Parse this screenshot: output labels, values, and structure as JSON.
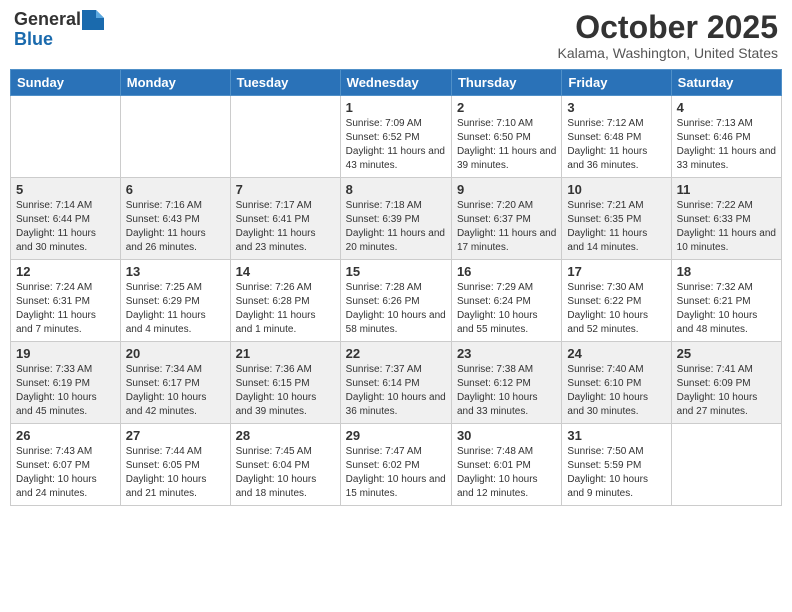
{
  "header": {
    "logo_general": "General",
    "logo_blue": "Blue",
    "month": "October 2025",
    "location": "Kalama, Washington, United States"
  },
  "days_of_week": [
    "Sunday",
    "Monday",
    "Tuesday",
    "Wednesday",
    "Thursday",
    "Friday",
    "Saturday"
  ],
  "weeks": [
    [
      {
        "day": "",
        "sunrise": "",
        "sunset": "",
        "daylight": ""
      },
      {
        "day": "",
        "sunrise": "",
        "sunset": "",
        "daylight": ""
      },
      {
        "day": "",
        "sunrise": "",
        "sunset": "",
        "daylight": ""
      },
      {
        "day": "1",
        "sunrise": "Sunrise: 7:09 AM",
        "sunset": "Sunset: 6:52 PM",
        "daylight": "Daylight: 11 hours and 43 minutes."
      },
      {
        "day": "2",
        "sunrise": "Sunrise: 7:10 AM",
        "sunset": "Sunset: 6:50 PM",
        "daylight": "Daylight: 11 hours and 39 minutes."
      },
      {
        "day": "3",
        "sunrise": "Sunrise: 7:12 AM",
        "sunset": "Sunset: 6:48 PM",
        "daylight": "Daylight: 11 hours and 36 minutes."
      },
      {
        "day": "4",
        "sunrise": "Sunrise: 7:13 AM",
        "sunset": "Sunset: 6:46 PM",
        "daylight": "Daylight: 11 hours and 33 minutes."
      }
    ],
    [
      {
        "day": "5",
        "sunrise": "Sunrise: 7:14 AM",
        "sunset": "Sunset: 6:44 PM",
        "daylight": "Daylight: 11 hours and 30 minutes."
      },
      {
        "day": "6",
        "sunrise": "Sunrise: 7:16 AM",
        "sunset": "Sunset: 6:43 PM",
        "daylight": "Daylight: 11 hours and 26 minutes."
      },
      {
        "day": "7",
        "sunrise": "Sunrise: 7:17 AM",
        "sunset": "Sunset: 6:41 PM",
        "daylight": "Daylight: 11 hours and 23 minutes."
      },
      {
        "day": "8",
        "sunrise": "Sunrise: 7:18 AM",
        "sunset": "Sunset: 6:39 PM",
        "daylight": "Daylight: 11 hours and 20 minutes."
      },
      {
        "day": "9",
        "sunrise": "Sunrise: 7:20 AM",
        "sunset": "Sunset: 6:37 PM",
        "daylight": "Daylight: 11 hours and 17 minutes."
      },
      {
        "day": "10",
        "sunrise": "Sunrise: 7:21 AM",
        "sunset": "Sunset: 6:35 PM",
        "daylight": "Daylight: 11 hours and 14 minutes."
      },
      {
        "day": "11",
        "sunrise": "Sunrise: 7:22 AM",
        "sunset": "Sunset: 6:33 PM",
        "daylight": "Daylight: 11 hours and 10 minutes."
      }
    ],
    [
      {
        "day": "12",
        "sunrise": "Sunrise: 7:24 AM",
        "sunset": "Sunset: 6:31 PM",
        "daylight": "Daylight: 11 hours and 7 minutes."
      },
      {
        "day": "13",
        "sunrise": "Sunrise: 7:25 AM",
        "sunset": "Sunset: 6:29 PM",
        "daylight": "Daylight: 11 hours and 4 minutes."
      },
      {
        "day": "14",
        "sunrise": "Sunrise: 7:26 AM",
        "sunset": "Sunset: 6:28 PM",
        "daylight": "Daylight: 11 hours and 1 minute."
      },
      {
        "day": "15",
        "sunrise": "Sunrise: 7:28 AM",
        "sunset": "Sunset: 6:26 PM",
        "daylight": "Daylight: 10 hours and 58 minutes."
      },
      {
        "day": "16",
        "sunrise": "Sunrise: 7:29 AM",
        "sunset": "Sunset: 6:24 PM",
        "daylight": "Daylight: 10 hours and 55 minutes."
      },
      {
        "day": "17",
        "sunrise": "Sunrise: 7:30 AM",
        "sunset": "Sunset: 6:22 PM",
        "daylight": "Daylight: 10 hours and 52 minutes."
      },
      {
        "day": "18",
        "sunrise": "Sunrise: 7:32 AM",
        "sunset": "Sunset: 6:21 PM",
        "daylight": "Daylight: 10 hours and 48 minutes."
      }
    ],
    [
      {
        "day": "19",
        "sunrise": "Sunrise: 7:33 AM",
        "sunset": "Sunset: 6:19 PM",
        "daylight": "Daylight: 10 hours and 45 minutes."
      },
      {
        "day": "20",
        "sunrise": "Sunrise: 7:34 AM",
        "sunset": "Sunset: 6:17 PM",
        "daylight": "Daylight: 10 hours and 42 minutes."
      },
      {
        "day": "21",
        "sunrise": "Sunrise: 7:36 AM",
        "sunset": "Sunset: 6:15 PM",
        "daylight": "Daylight: 10 hours and 39 minutes."
      },
      {
        "day": "22",
        "sunrise": "Sunrise: 7:37 AM",
        "sunset": "Sunset: 6:14 PM",
        "daylight": "Daylight: 10 hours and 36 minutes."
      },
      {
        "day": "23",
        "sunrise": "Sunrise: 7:38 AM",
        "sunset": "Sunset: 6:12 PM",
        "daylight": "Daylight: 10 hours and 33 minutes."
      },
      {
        "day": "24",
        "sunrise": "Sunrise: 7:40 AM",
        "sunset": "Sunset: 6:10 PM",
        "daylight": "Daylight: 10 hours and 30 minutes."
      },
      {
        "day": "25",
        "sunrise": "Sunrise: 7:41 AM",
        "sunset": "Sunset: 6:09 PM",
        "daylight": "Daylight: 10 hours and 27 minutes."
      }
    ],
    [
      {
        "day": "26",
        "sunrise": "Sunrise: 7:43 AM",
        "sunset": "Sunset: 6:07 PM",
        "daylight": "Daylight: 10 hours and 24 minutes."
      },
      {
        "day": "27",
        "sunrise": "Sunrise: 7:44 AM",
        "sunset": "Sunset: 6:05 PM",
        "daylight": "Daylight: 10 hours and 21 minutes."
      },
      {
        "day": "28",
        "sunrise": "Sunrise: 7:45 AM",
        "sunset": "Sunset: 6:04 PM",
        "daylight": "Daylight: 10 hours and 18 minutes."
      },
      {
        "day": "29",
        "sunrise": "Sunrise: 7:47 AM",
        "sunset": "Sunset: 6:02 PM",
        "daylight": "Daylight: 10 hours and 15 minutes."
      },
      {
        "day": "30",
        "sunrise": "Sunrise: 7:48 AM",
        "sunset": "Sunset: 6:01 PM",
        "daylight": "Daylight: 10 hours and 12 minutes."
      },
      {
        "day": "31",
        "sunrise": "Sunrise: 7:50 AM",
        "sunset": "Sunset: 5:59 PM",
        "daylight": "Daylight: 10 hours and 9 minutes."
      },
      {
        "day": "",
        "sunrise": "",
        "sunset": "",
        "daylight": ""
      }
    ]
  ]
}
